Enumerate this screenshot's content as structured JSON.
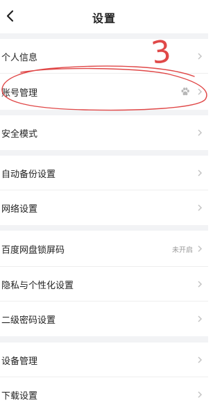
{
  "header": {
    "title": "设置"
  },
  "groups": [
    {
      "items": [
        {
          "label": "个人信息"
        },
        {
          "label": "账号管理"
        }
      ]
    },
    {
      "items": [
        {
          "label": "安全模式"
        }
      ]
    },
    {
      "items": [
        {
          "label": "自动备份设置"
        },
        {
          "label": "网络设置"
        }
      ]
    },
    {
      "items": [
        {
          "label": "百度网盘锁屏码",
          "status": "未开启"
        },
        {
          "label": "隐私与个性化设置"
        },
        {
          "label": "二级密码设置"
        }
      ]
    },
    {
      "items": [
        {
          "label": "设备管理"
        },
        {
          "label": "下载设置"
        }
      ]
    }
  ],
  "annotation": {
    "text": "3",
    "color": "#e04848"
  },
  "icons": {
    "back": "chevron-left-icon",
    "row_arrow": "chevron-right-icon",
    "account": "paw-icon"
  },
  "colors": {
    "section_gap": "#f2f3f5",
    "chevron": "#c4c4c4"
  }
}
